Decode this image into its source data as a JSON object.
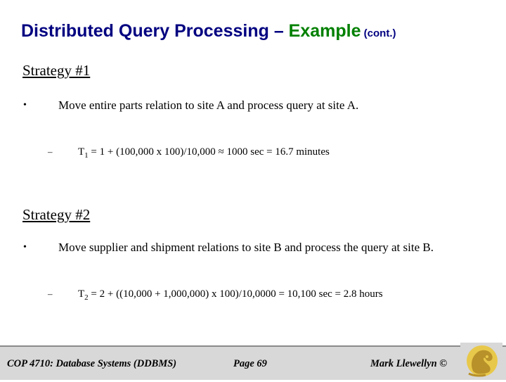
{
  "slide": {
    "title": {
      "part1": "Distributed Query Processing – ",
      "part2": "Example",
      "part3": " (cont.)"
    },
    "strategy1": {
      "heading": "Strategy #1",
      "bullet_marker": "•",
      "bullet_text": "Move entire parts relation to site A and process query at site A.",
      "sub_marker": "–",
      "sub_prefix": "T",
      "sub_subscript": "1",
      "sub_text": " = 1 + (100,000 x 100)/10,000 ≈ 1000 sec = 16.7 minutes"
    },
    "strategy2": {
      "heading": "Strategy #2",
      "bullet_marker": "•",
      "bullet_text": "Move supplier and shipment relations to site B and process the query at site B.",
      "sub_marker": "–",
      "sub_prefix": "T",
      "sub_subscript": "2",
      "sub_text": " = 2 + ((10,000 + 1,000,000) x 100)/10,0000 = 10,100 sec = 2.8 hours"
    },
    "footer": {
      "left": "COP 4710: Database Systems  (DDBMS)",
      "center": "Page 69",
      "right": "Mark Llewellyn ©"
    },
    "colors": {
      "title_blue": "#000080",
      "title_green": "#008000",
      "footer_bg": "#d8d8d8"
    }
  }
}
